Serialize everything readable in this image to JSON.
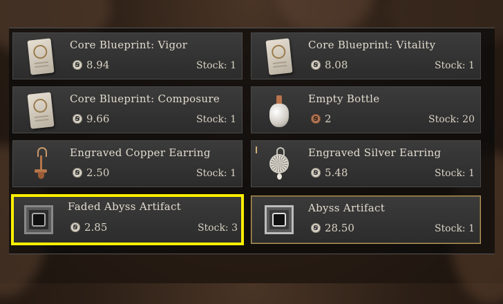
{
  "shop": {
    "items": [
      {
        "name": "Core Blueprint: Vigor",
        "price": "8.94",
        "stock": "Stock: 1",
        "icon": "blueprint-icon",
        "coin": "silver-coin-icon"
      },
      {
        "name": "Core Blueprint: Vitality",
        "price": "8.08",
        "stock": "Stock: 1",
        "icon": "blueprint-icon",
        "coin": "silver-coin-icon"
      },
      {
        "name": "Core Blueprint: Composure",
        "price": "9.66",
        "stock": "Stock: 1",
        "icon": "blueprint-icon",
        "coin": "silver-coin-icon"
      },
      {
        "name": "Empty Bottle",
        "price": "2",
        "stock": "Stock: 20",
        "icon": "bottle-icon",
        "coin": "copper-coin-icon"
      },
      {
        "name": "Engraved Copper Earring",
        "price": "2.50",
        "stock": "Stock: 1",
        "icon": "copper-earring-icon",
        "coin": "silver-coin-icon"
      },
      {
        "name": "Engraved Silver Earring",
        "price": "5.48",
        "stock": "Stock: 1",
        "icon": "silver-earring-icon",
        "coin": "silver-coin-icon"
      },
      {
        "name": "Faded Abyss Artifact",
        "price": "2.85",
        "stock": "Stock: 3",
        "icon": "faded-abyss-artifact-icon",
        "coin": "silver-coin-icon"
      },
      {
        "name": "Abyss Artifact",
        "price": "28.50",
        "stock": "Stock: 1",
        "icon": "abyss-artifact-icon",
        "coin": "silver-coin-icon"
      }
    ],
    "coin_glyph": "⚱",
    "highlight_color": "#ffef00",
    "selected_border_color": "#b89a5e"
  }
}
